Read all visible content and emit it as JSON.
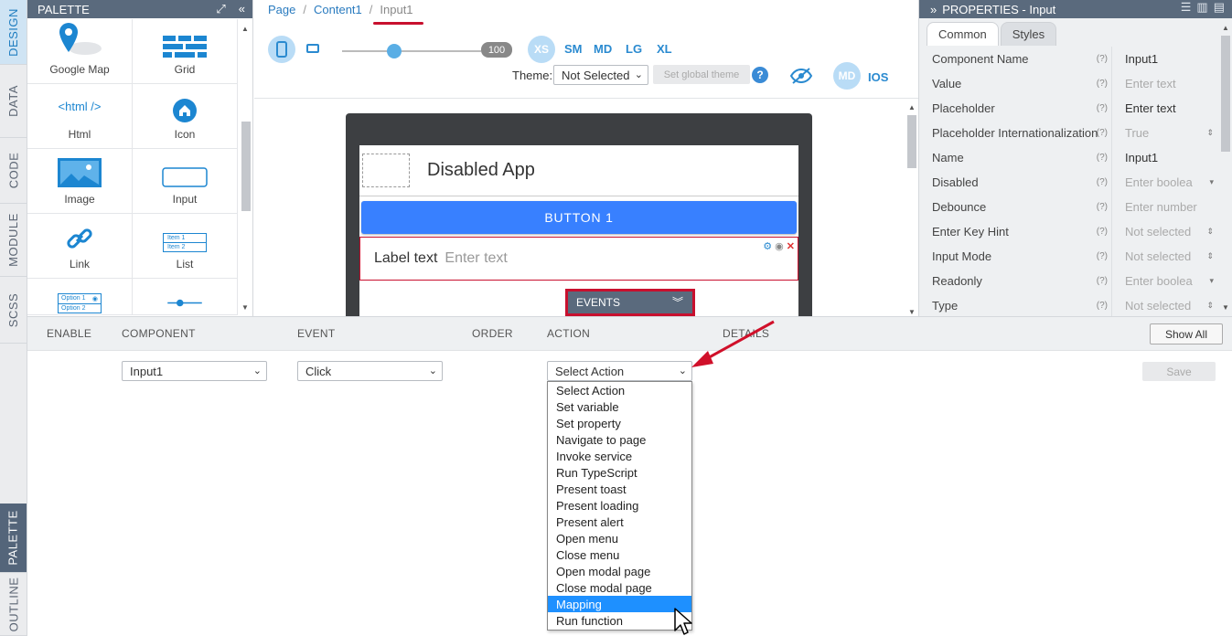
{
  "vtabs": {
    "top": [
      "DESIGN",
      "DATA",
      "CODE",
      "MODULE",
      "SCSS"
    ],
    "bottom": [
      "PALETTE",
      "OUTLINE"
    ]
  },
  "palette": {
    "title": "PALETTE",
    "items": [
      "Google Map",
      "Grid",
      "Html",
      "Icon",
      "Image",
      "Input",
      "Link",
      "List",
      "",
      ""
    ],
    "html_glyph": "<html />",
    "list_item1": "Item 1",
    "list_item2": "Item 2",
    "option1": "Option 1",
    "option2": "Option 2"
  },
  "breadcrumb": {
    "page": "Page",
    "content": "Content1",
    "current": "Input1",
    "separator": "/"
  },
  "toolbar": {
    "zoom_value": "100",
    "breakpoints": [
      "XS",
      "SM",
      "MD",
      "LG",
      "XL"
    ],
    "theme_label": "Theme:",
    "theme_value": "Not Selected",
    "set_global_theme": "Set global theme",
    "help": "?",
    "mode_md": "MD",
    "mode_ios": "IOS"
  },
  "app": {
    "title": "Disabled App",
    "button_label": "BUTTON 1",
    "input_label": "Label text",
    "input_placeholder": "Enter text",
    "events_label": "EVENTS"
  },
  "properties": {
    "title": "PROPERTIES - Input",
    "tabs": [
      "Common",
      "Styles"
    ],
    "help_mark": "(?)",
    "rows": [
      {
        "name": "Component Name",
        "value": "Input1",
        "placeholder": false
      },
      {
        "name": "Value",
        "value": "Enter text",
        "placeholder": true
      },
      {
        "name": "Placeholder",
        "value": "Enter text",
        "placeholder": false
      },
      {
        "name": "Placeholder Internationalization",
        "value": "True",
        "placeholder": true
      },
      {
        "name": "Name",
        "value": "Input1",
        "placeholder": false
      },
      {
        "name": "Disabled",
        "value": "Enter boolea",
        "placeholder": true
      },
      {
        "name": "Debounce",
        "value": "Enter number",
        "placeholder": true
      },
      {
        "name": "Enter Key Hint",
        "value": "Not selected",
        "placeholder": true
      },
      {
        "name": "Input Mode",
        "value": "Not selected",
        "placeholder": true
      },
      {
        "name": "Readonly",
        "value": "Enter boolea",
        "placeholder": true
      },
      {
        "name": "Type",
        "value": "Not selected",
        "placeholder": true
      }
    ]
  },
  "events_panel": {
    "columns": [
      "ENABLE",
      "COMPONENT",
      "EVENT",
      "ORDER",
      "ACTION",
      "DETAILS"
    ],
    "show_all": "Show All",
    "component_value": "Input1",
    "event_value": "Click",
    "action_value": "Select Action",
    "save": "Save",
    "action_options": [
      "Select Action",
      "Set variable",
      "Set property",
      "Navigate to page",
      "Invoke service",
      "Run TypeScript",
      "Present toast",
      "Present loading",
      "Present alert",
      "Open menu",
      "Close menu",
      "Open modal page",
      "Close modal page",
      "Mapping",
      "Run function"
    ],
    "highlighted_option": "Mapping"
  },
  "colors": {
    "accent": "#3880ff",
    "highlight_red": "#c8102e",
    "header_slate": "#5a6a7d",
    "breakpoint_blue": "#2a8ad0"
  }
}
